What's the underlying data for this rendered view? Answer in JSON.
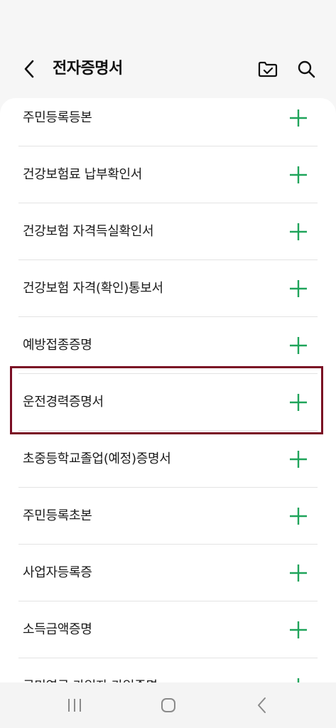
{
  "header": {
    "title": "전자증명서"
  },
  "icons": {
    "back": "chevron-left-icon",
    "folder": "folder-check-icon",
    "search": "search-icon",
    "add": "plus-icon"
  },
  "colors": {
    "accent_green": "#1fa45a",
    "highlight_border": "#7a0e24"
  },
  "list": {
    "items": [
      {
        "label": "주민등록등본"
      },
      {
        "label": "건강보험료 납부확인서"
      },
      {
        "label": "건강보험 자격득실확인서"
      },
      {
        "label": "건강보험 자격(확인)통보서"
      },
      {
        "label": "예방접종증명"
      },
      {
        "label": "운전경력증명서"
      },
      {
        "label": "초중등학교졸업(예정)증명서"
      },
      {
        "label": "주민등록초본"
      },
      {
        "label": "사업자등록증"
      },
      {
        "label": "소득금액증명"
      },
      {
        "label": "국민연금 가입자 가입증명"
      }
    ],
    "highlighted_index": 5
  },
  "nav": {
    "recents": "recents-icon",
    "home": "home-icon",
    "back": "back-icon"
  }
}
